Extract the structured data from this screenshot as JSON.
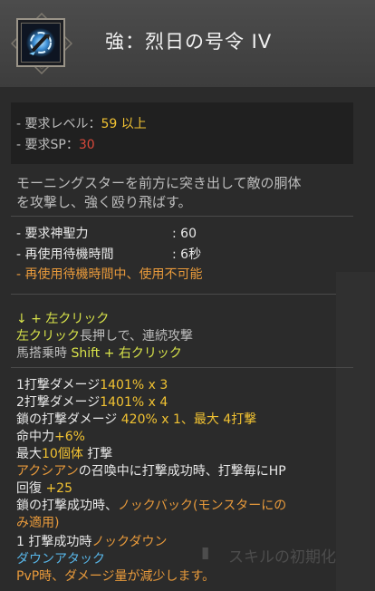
{
  "skill": {
    "title": "強：烈日の号令 IV",
    "icon": "morning-star-skill-icon"
  },
  "requirements": {
    "level_label": "- 要求レベル：",
    "level_value": "59 以上",
    "sp_label": "- 要求SP：",
    "sp_value": "30"
  },
  "description": {
    "line1": "モーニングスターを前方に突き出して敵の胴体",
    "line2": "を攻撃し、強く殴り飛ばす。"
  },
  "stats": {
    "divine_label": "- 要求神聖力",
    "divine_value": ": 60",
    "cooldown_label": "- 再使用待機時間",
    "cooldown_value": ": 6秒",
    "cooldown_note": "- 再使用待機時間中、使用不可能"
  },
  "controls": {
    "line1": "↓ + 左クリック",
    "line2_key": "左クリック",
    "line2_rest": "長押しで、連続攻撃",
    "line3_prefix": "馬搭乗時 ",
    "line3_key": "Shift + 右クリック"
  },
  "effects": {
    "hit1_label": "1打撃ダメージ",
    "hit1_value": "1401% x 3",
    "hit2_label": "2打撃ダメージ",
    "hit2_value": "1401% x 4",
    "chain_label": "鎖の打撃ダメージ ",
    "chain_value": "420% x 1、最大 4打撃",
    "accuracy_label": "命中力",
    "accuracy_value": "+6%",
    "max_prefix": "最大",
    "max_value": "10個体",
    "max_suffix": " 打撃",
    "acshian_name": "アクシアン",
    "acshian_text": "の召喚中に打撃成功時、打撃毎にHP",
    "recovery_label": "回復 ",
    "recovery_value": "+25",
    "knockback_prefix": "鎖の打撃成功時、",
    "knockback_value": "ノックバック(モンスターにの",
    "knockback_value2": "み適用)",
    "knockdown_prefix": "1 打撃成功時",
    "knockdown_value": "ノックダウン",
    "down_attack": "ダウンアタック",
    "pvp_note": "PvP時、ダメージ量が減少します。"
  },
  "background": {
    "reset_label": "スキルの初期化"
  }
}
